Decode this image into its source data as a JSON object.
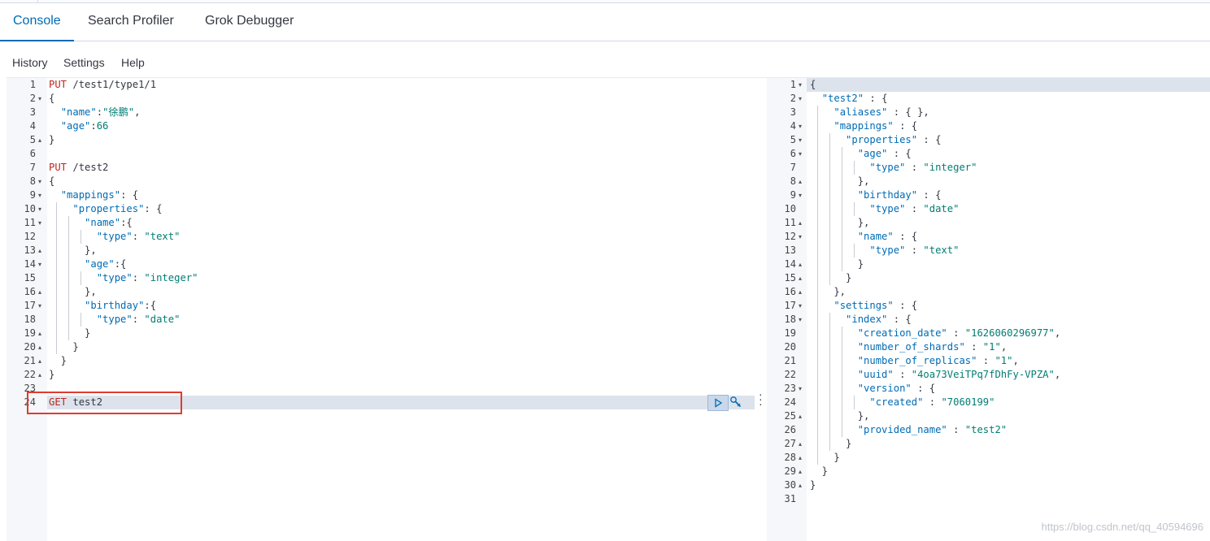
{
  "tabs": [
    {
      "label": "Console",
      "active": true
    },
    {
      "label": "Search Profiler",
      "active": false
    },
    {
      "label": "Grok Debugger",
      "active": false
    }
  ],
  "menu": [
    {
      "label": "History"
    },
    {
      "label": "Settings"
    },
    {
      "label": "Help"
    }
  ],
  "request_editor": {
    "active_line": 24,
    "lines": [
      {
        "n": "1",
        "fold": "",
        "segs": [
          [
            "m",
            "PUT"
          ],
          [
            "n",
            " /test1/type1/1"
          ]
        ]
      },
      {
        "n": "2",
        "fold": "▾",
        "segs": [
          [
            "p",
            "{"
          ]
        ]
      },
      {
        "n": "3",
        "fold": "",
        "segs": [
          [
            "p",
            "  "
          ],
          [
            "k",
            "\"name\""
          ],
          [
            "p",
            ":"
          ],
          [
            "s",
            "\"徐鹏\""
          ],
          [
            "p",
            ","
          ]
        ]
      },
      {
        "n": "4",
        "fold": "",
        "segs": [
          [
            "p",
            "  "
          ],
          [
            "k",
            "\"age\""
          ],
          [
            "p",
            ":"
          ],
          [
            "s",
            "66"
          ]
        ]
      },
      {
        "n": "5",
        "fold": "▴",
        "segs": [
          [
            "p",
            "}"
          ]
        ]
      },
      {
        "n": "6",
        "fold": "",
        "segs": []
      },
      {
        "n": "7",
        "fold": "",
        "segs": [
          [
            "m",
            "PUT"
          ],
          [
            "n",
            " /test2"
          ]
        ]
      },
      {
        "n": "8",
        "fold": "▾",
        "segs": [
          [
            "p",
            "{"
          ]
        ]
      },
      {
        "n": "9",
        "fold": "▾",
        "segs": [
          [
            "p",
            "  "
          ],
          [
            "k",
            "\"mappings\""
          ],
          [
            "p",
            ": {"
          ]
        ]
      },
      {
        "n": "10",
        "fold": "▾",
        "segs": [
          [
            "p",
            "    "
          ],
          [
            "k",
            "\"properties\""
          ],
          [
            "p",
            ": {"
          ]
        ]
      },
      {
        "n": "11",
        "fold": "▾",
        "segs": [
          [
            "p",
            "      "
          ],
          [
            "k",
            "\"name\""
          ],
          [
            "p",
            ":{"
          ]
        ]
      },
      {
        "n": "12",
        "fold": "",
        "segs": [
          [
            "p",
            "        "
          ],
          [
            "k",
            "\"type\""
          ],
          [
            "p",
            ": "
          ],
          [
            "s",
            "\"text\""
          ]
        ]
      },
      {
        "n": "13",
        "fold": "▴",
        "segs": [
          [
            "p",
            "      },"
          ]
        ]
      },
      {
        "n": "14",
        "fold": "▾",
        "segs": [
          [
            "p",
            "      "
          ],
          [
            "k",
            "\"age\""
          ],
          [
            "p",
            ":{"
          ]
        ]
      },
      {
        "n": "15",
        "fold": "",
        "segs": [
          [
            "p",
            "        "
          ],
          [
            "k",
            "\"type\""
          ],
          [
            "p",
            ": "
          ],
          [
            "s",
            "\"integer\""
          ]
        ]
      },
      {
        "n": "16",
        "fold": "▴",
        "segs": [
          [
            "p",
            "      },"
          ]
        ]
      },
      {
        "n": "17",
        "fold": "▾",
        "segs": [
          [
            "p",
            "      "
          ],
          [
            "k",
            "\"birthday\""
          ],
          [
            "p",
            ":{"
          ]
        ]
      },
      {
        "n": "18",
        "fold": "",
        "segs": [
          [
            "p",
            "        "
          ],
          [
            "k",
            "\"type\""
          ],
          [
            "p",
            ": "
          ],
          [
            "s",
            "\"date\""
          ]
        ]
      },
      {
        "n": "19",
        "fold": "▴",
        "segs": [
          [
            "p",
            "      }"
          ]
        ]
      },
      {
        "n": "20",
        "fold": "▴",
        "segs": [
          [
            "p",
            "    }"
          ]
        ]
      },
      {
        "n": "21",
        "fold": "▴",
        "segs": [
          [
            "p",
            "  }"
          ]
        ]
      },
      {
        "n": "22",
        "fold": "▴",
        "segs": [
          [
            "p",
            "}"
          ]
        ]
      },
      {
        "n": "23",
        "fold": "",
        "segs": []
      },
      {
        "n": "24",
        "fold": "",
        "segs": [
          [
            "m",
            "GET"
          ],
          [
            "n",
            " test2"
          ]
        ]
      }
    ]
  },
  "response_viewer": {
    "lines": [
      {
        "n": "1",
        "fold": "▾",
        "segs": [
          [
            "p",
            "{"
          ]
        ]
      },
      {
        "n": "2",
        "fold": "▾",
        "segs": [
          [
            "p",
            "  "
          ],
          [
            "k",
            "\"test2\""
          ],
          [
            "p",
            " : {"
          ]
        ]
      },
      {
        "n": "3",
        "fold": "",
        "segs": [
          [
            "p",
            "    "
          ],
          [
            "k",
            "\"aliases\""
          ],
          [
            "p",
            " : { },"
          ]
        ]
      },
      {
        "n": "4",
        "fold": "▾",
        "segs": [
          [
            "p",
            "    "
          ],
          [
            "k",
            "\"mappings\""
          ],
          [
            "p",
            " : {"
          ]
        ]
      },
      {
        "n": "5",
        "fold": "▾",
        "segs": [
          [
            "p",
            "      "
          ],
          [
            "k",
            "\"properties\""
          ],
          [
            "p",
            " : {"
          ]
        ]
      },
      {
        "n": "6",
        "fold": "▾",
        "segs": [
          [
            "p",
            "        "
          ],
          [
            "k",
            "\"age\""
          ],
          [
            "p",
            " : {"
          ]
        ]
      },
      {
        "n": "7",
        "fold": "",
        "segs": [
          [
            "p",
            "          "
          ],
          [
            "k",
            "\"type\""
          ],
          [
            "p",
            " : "
          ],
          [
            "s",
            "\"integer\""
          ]
        ]
      },
      {
        "n": "8",
        "fold": "▴",
        "segs": [
          [
            "p",
            "        },"
          ]
        ]
      },
      {
        "n": "9",
        "fold": "▾",
        "segs": [
          [
            "p",
            "        "
          ],
          [
            "k",
            "\"birthday\""
          ],
          [
            "p",
            " : {"
          ]
        ]
      },
      {
        "n": "10",
        "fold": "",
        "segs": [
          [
            "p",
            "          "
          ],
          [
            "k",
            "\"type\""
          ],
          [
            "p",
            " : "
          ],
          [
            "s",
            "\"date\""
          ]
        ]
      },
      {
        "n": "11",
        "fold": "▴",
        "segs": [
          [
            "p",
            "        },"
          ]
        ]
      },
      {
        "n": "12",
        "fold": "▾",
        "segs": [
          [
            "p",
            "        "
          ],
          [
            "k",
            "\"name\""
          ],
          [
            "p",
            " : {"
          ]
        ]
      },
      {
        "n": "13",
        "fold": "",
        "segs": [
          [
            "p",
            "          "
          ],
          [
            "k",
            "\"type\""
          ],
          [
            "p",
            " : "
          ],
          [
            "s",
            "\"text\""
          ]
        ]
      },
      {
        "n": "14",
        "fold": "▴",
        "segs": [
          [
            "p",
            "        }"
          ]
        ]
      },
      {
        "n": "15",
        "fold": "▴",
        "segs": [
          [
            "p",
            "      }"
          ]
        ]
      },
      {
        "n": "16",
        "fold": "▴",
        "segs": [
          [
            "p",
            "    },"
          ]
        ]
      },
      {
        "n": "17",
        "fold": "▾",
        "segs": [
          [
            "p",
            "    "
          ],
          [
            "k",
            "\"settings\""
          ],
          [
            "p",
            " : {"
          ]
        ]
      },
      {
        "n": "18",
        "fold": "▾",
        "segs": [
          [
            "p",
            "      "
          ],
          [
            "k",
            "\"index\""
          ],
          [
            "p",
            " : {"
          ]
        ]
      },
      {
        "n": "19",
        "fold": "",
        "segs": [
          [
            "p",
            "        "
          ],
          [
            "k",
            "\"creation_date\""
          ],
          [
            "p",
            " : "
          ],
          [
            "s",
            "\"1626060296977\""
          ],
          [
            "p",
            ","
          ]
        ]
      },
      {
        "n": "20",
        "fold": "",
        "segs": [
          [
            "p",
            "        "
          ],
          [
            "k",
            "\"number_of_shards\""
          ],
          [
            "p",
            " : "
          ],
          [
            "s",
            "\"1\""
          ],
          [
            "p",
            ","
          ]
        ]
      },
      {
        "n": "21",
        "fold": "",
        "segs": [
          [
            "p",
            "        "
          ],
          [
            "k",
            "\"number_of_replicas\""
          ],
          [
            "p",
            " : "
          ],
          [
            "s",
            "\"1\""
          ],
          [
            "p",
            ","
          ]
        ]
      },
      {
        "n": "22",
        "fold": "",
        "segs": [
          [
            "p",
            "        "
          ],
          [
            "k",
            "\"uuid\""
          ],
          [
            "p",
            " : "
          ],
          [
            "s",
            "\"4oa73VeiTPq7fDhFy-VPZA\""
          ],
          [
            "p",
            ","
          ]
        ]
      },
      {
        "n": "23",
        "fold": "▾",
        "segs": [
          [
            "p",
            "        "
          ],
          [
            "k",
            "\"version\""
          ],
          [
            "p",
            " : {"
          ]
        ]
      },
      {
        "n": "24",
        "fold": "",
        "segs": [
          [
            "p",
            "          "
          ],
          [
            "k",
            "\"created\""
          ],
          [
            "p",
            " : "
          ],
          [
            "s",
            "\"7060199\""
          ]
        ]
      },
      {
        "n": "25",
        "fold": "▴",
        "segs": [
          [
            "p",
            "        },"
          ]
        ]
      },
      {
        "n": "26",
        "fold": "",
        "segs": [
          [
            "p",
            "        "
          ],
          [
            "k",
            "\"provided_name\""
          ],
          [
            "p",
            " : "
          ],
          [
            "s",
            "\"test2\""
          ]
        ]
      },
      {
        "n": "27",
        "fold": "▴",
        "segs": [
          [
            "p",
            "      }"
          ]
        ]
      },
      {
        "n": "28",
        "fold": "▴",
        "segs": [
          [
            "p",
            "    }"
          ]
        ]
      },
      {
        "n": "29",
        "fold": "▴",
        "segs": [
          [
            "p",
            "  }"
          ]
        ]
      },
      {
        "n": "30",
        "fold": "▴",
        "segs": [
          [
            "p",
            "}"
          ]
        ]
      },
      {
        "n": "31",
        "fold": "",
        "segs": []
      }
    ]
  },
  "actions": {
    "run_icon": "play-icon",
    "settings_icon": "wrench-icon"
  },
  "watermark": "https://blog.csdn.net/qq_40594696",
  "colors": {
    "accent": "#006bb4",
    "method": "#bd271e",
    "string": "#017d73",
    "highlight_box": "#e23a2f"
  }
}
